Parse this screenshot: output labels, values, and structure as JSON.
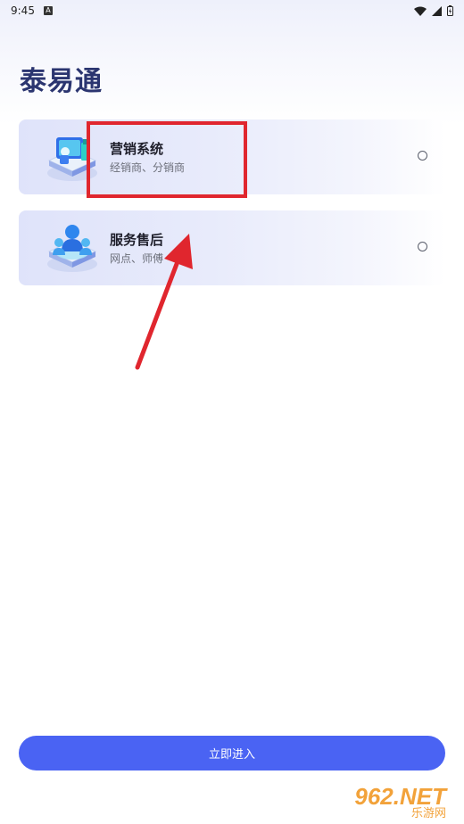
{
  "status_bar": {
    "time": "9:45",
    "notification_letter": "A"
  },
  "app_title": "泰易通",
  "options": [
    {
      "title": "营销系统",
      "subtitle": "经销商、分销商",
      "selected": false
    },
    {
      "title": "服务售后",
      "subtitle": "网点、师傅",
      "selected": false
    }
  ],
  "enter_button": {
    "label": "立即进入"
  },
  "watermark": {
    "brand": "962.NET",
    "sub": "乐游网"
  },
  "colors": {
    "accent": "#4a63f3",
    "title": "#2b3570",
    "highlight": "#e0262e",
    "watermark": "#f2a23a"
  }
}
